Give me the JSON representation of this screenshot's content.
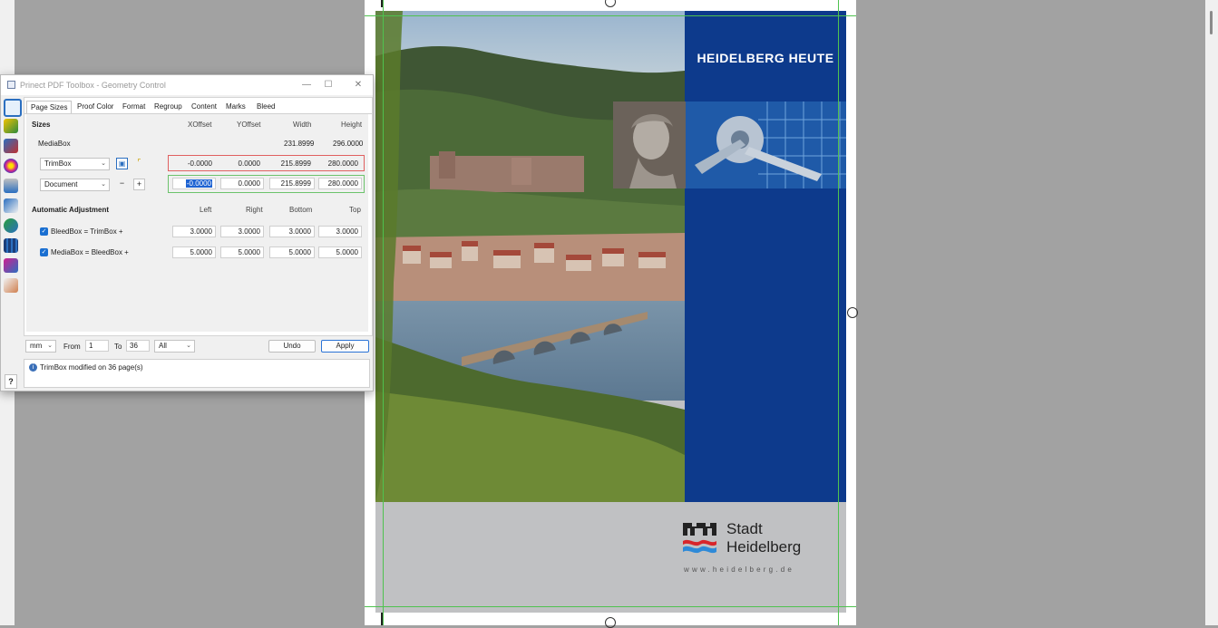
{
  "window": {
    "title": "Prinect PDF Toolbox - Geometry Control",
    "controls": [
      "—",
      "☐",
      "✕"
    ]
  },
  "tabs": [
    "Page Sizes",
    "Proof Color",
    "Format",
    "Regroup",
    "Content",
    "Marks",
    "Bleed"
  ],
  "active_tab": "Page Sizes",
  "sizes": {
    "section_label": "Sizes",
    "headers": {
      "xoffset": "XOffset",
      "yoffset": "YOffset",
      "width": "Width",
      "height": "Height"
    },
    "mediabox": {
      "label": "MediaBox",
      "width": "231.8999",
      "height": "296.0000"
    },
    "trimbox": {
      "selected": "TrimBox",
      "xoffset": "-0.0000",
      "yoffset": "0.0000",
      "width": "215.8999",
      "height": "280.0000"
    },
    "document": {
      "selected": "Document",
      "xoffset": "-0.0000",
      "yoffset": "0.0000",
      "width": "215.8999",
      "height": "280.0000"
    }
  },
  "auto_adjust": {
    "section_label": "Automatic Adjustment",
    "headers": {
      "left": "Left",
      "right": "Right",
      "bottom": "Bottom",
      "top": "Top"
    },
    "rows": [
      {
        "label": "BleedBox = TrimBox +",
        "checked": true,
        "left": "3.0000",
        "right": "3.0000",
        "bottom": "3.0000",
        "top": "3.0000"
      },
      {
        "label": "MediaBox = BleedBox +",
        "checked": true,
        "left": "5.0000",
        "right": "5.0000",
        "bottom": "5.0000",
        "top": "5.0000"
      }
    ]
  },
  "footer": {
    "unit": "mm",
    "from_label": "From",
    "from_value": "1",
    "to_label": "To",
    "to_value": "36",
    "range": "All",
    "undo_label": "Undo",
    "apply_label": "Apply"
  },
  "status": {
    "message": "TrimBox modified on 36 page(s)"
  },
  "help_label": "?",
  "cover": {
    "title": "HEIDELBERG HEUTE",
    "logo_line1": "Stadt",
    "logo_line2": "Heidelberg",
    "url": "www.heidelberg.de"
  },
  "colors": {
    "blue_panel": "#0d3a8c",
    "guide_green": "#4fc24f",
    "trimbox_outline": "#e06060",
    "document_outline": "#6cc36c",
    "logo_red": "#d8262b",
    "logo_blue": "#2e8ad8"
  }
}
